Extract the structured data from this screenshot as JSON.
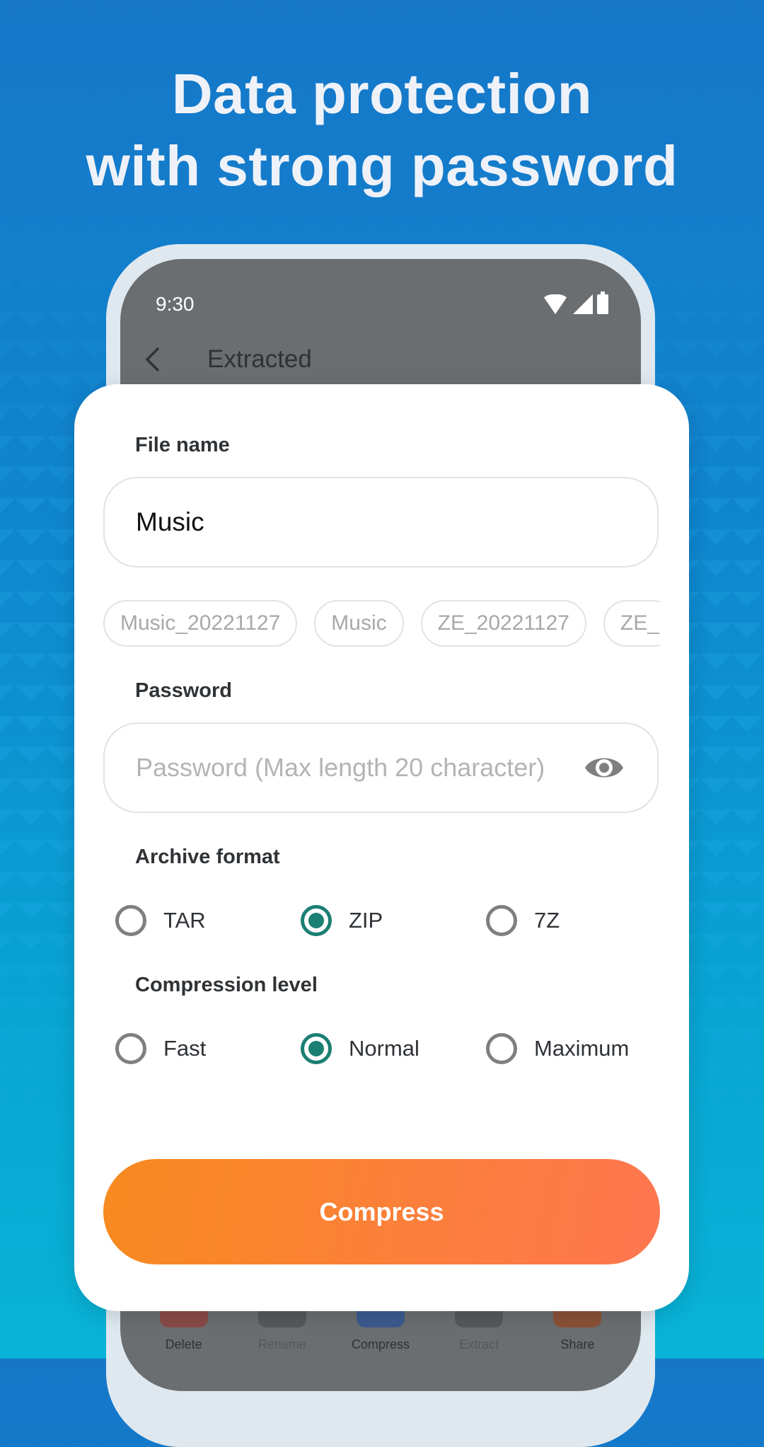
{
  "headline": {
    "line1": "Data protection",
    "line2": "with strong password"
  },
  "phone": {
    "status_time": "9:30",
    "appbar_title": "Extracted",
    "bottom_bar": [
      {
        "label": "Delete",
        "icon": "trash-icon",
        "color": "#8a4b48"
      },
      {
        "label": "Rename",
        "icon": "rename-icon",
        "color": "#55595c"
      },
      {
        "label": "Compress",
        "icon": "compress-icon",
        "color": "#3c5a8f"
      },
      {
        "label": "Extract",
        "icon": "extract-icon",
        "color": "#55595c"
      },
      {
        "label": "Share",
        "icon": "share-icon",
        "color": "#8b5238"
      }
    ]
  },
  "dialog": {
    "file_name_label": "File name",
    "file_name_value": "Music",
    "suggestions": [
      "Music_20221127",
      "Music",
      "ZE_20221127",
      "ZE_"
    ],
    "password_label": "Password",
    "password_placeholder": "Password (Max length 20 character)",
    "archive_format_label": "Archive format",
    "archive_formats": [
      "TAR",
      "ZIP",
      "7Z"
    ],
    "archive_format_selected": "ZIP",
    "compression_level_label": "Compression level",
    "compression_levels": [
      "Fast",
      "Normal",
      "Maximum"
    ],
    "compression_level_selected": "Normal",
    "compress_button": "Compress"
  },
  "colors": {
    "accent": "#1b7f73",
    "button_start": "#f78a1f",
    "button_end": "#ff7650"
  }
}
